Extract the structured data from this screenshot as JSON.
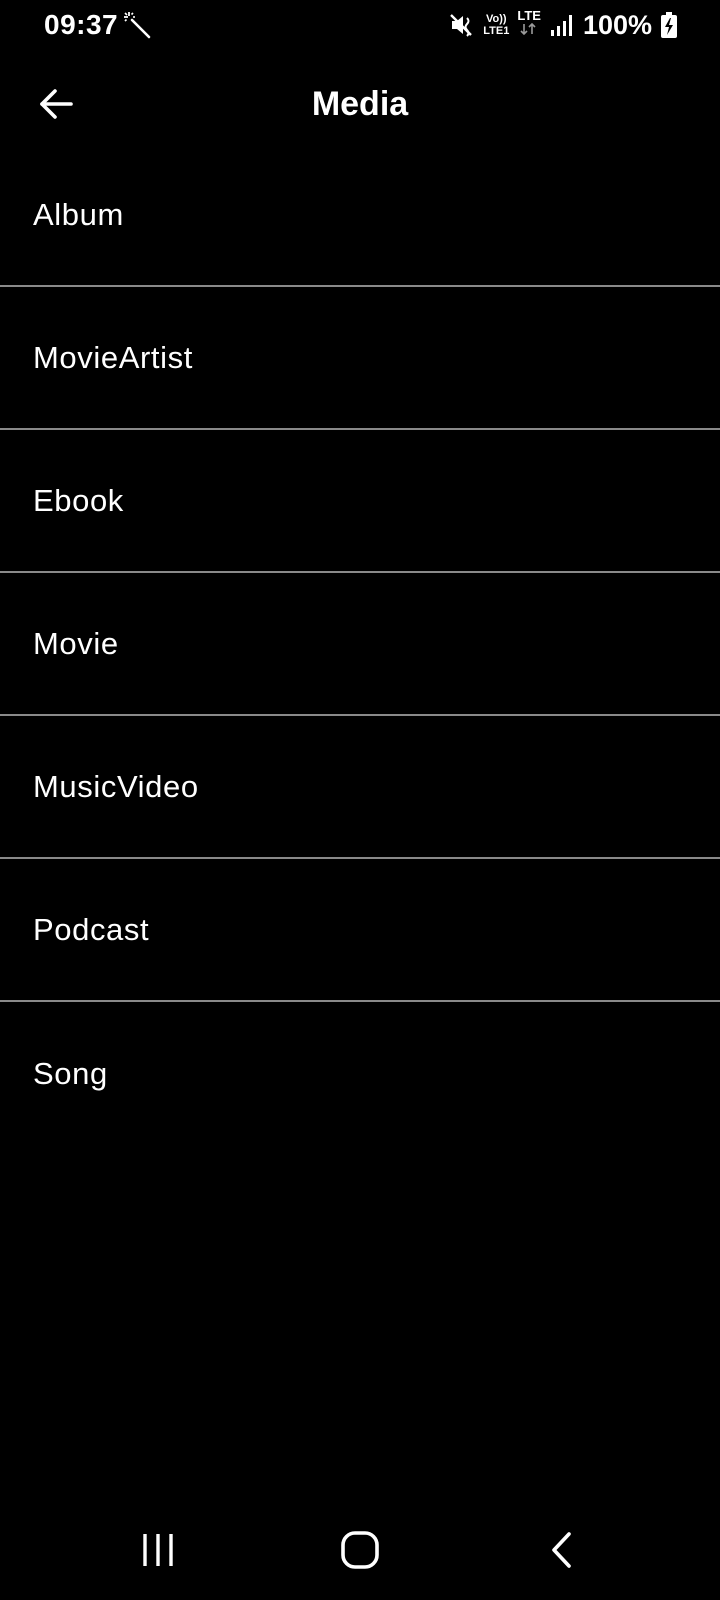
{
  "status_bar": {
    "time": "09:37",
    "volte_top": "Vo))",
    "volte_bottom": "LTE1",
    "network_label": "LTE",
    "battery_percent": "100%",
    "icons": [
      "magic-wand-icon",
      "mute-vibrate-icon",
      "volte-icon",
      "lte-data-icon",
      "signal-icon",
      "battery-charging-icon"
    ]
  },
  "app_bar": {
    "title": "Media",
    "back_icon": "arrow-left-icon"
  },
  "media_list": {
    "items": [
      {
        "label": "Album"
      },
      {
        "label": "MovieArtist"
      },
      {
        "label": "Ebook"
      },
      {
        "label": "Movie"
      },
      {
        "label": "MusicVideo"
      },
      {
        "label": "Podcast"
      },
      {
        "label": "Song"
      }
    ]
  },
  "nav_bar": {
    "icons": [
      "recent-apps-icon",
      "home-icon",
      "back-icon"
    ]
  },
  "colors": {
    "background": "#000000",
    "text": "#ffffff",
    "divider": "#8a8a8a"
  }
}
